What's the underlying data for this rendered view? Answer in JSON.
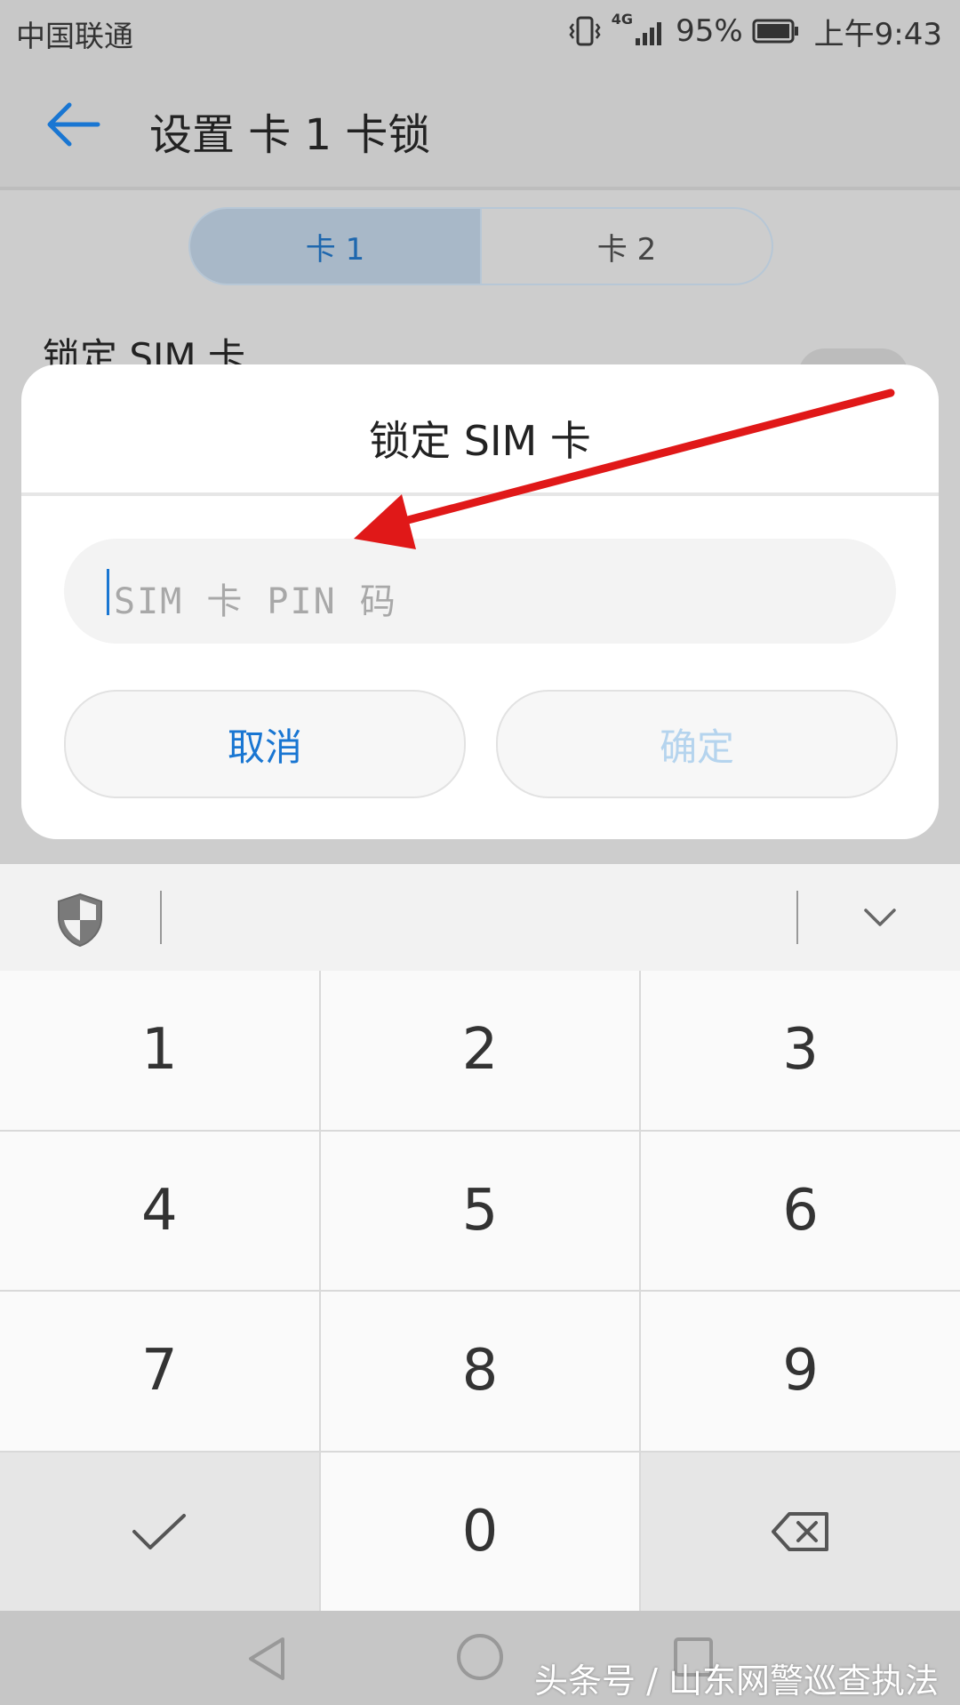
{
  "status_bar": {
    "carrier": "中国联通",
    "network": "4G",
    "battery": "95%",
    "time": "上午9:43",
    "icons": [
      "vibrate-icon",
      "signal-icon",
      "battery-icon"
    ]
  },
  "app_bar": {
    "title": "设置 卡 1 卡锁",
    "back_icon": "back-arrow-icon"
  },
  "sim_tabs": [
    "卡 1",
    "卡 2"
  ],
  "settings": {
    "lock_sim_label": "锁定 SIM 卡"
  },
  "dialog": {
    "title": "锁定 SIM 卡",
    "pin_placeholder": "SIM 卡 PIN 码",
    "cancel_label": "取消",
    "confirm_label": "确定"
  },
  "keyboard": {
    "keys": [
      "1",
      "2",
      "3",
      "4",
      "5",
      "6",
      "7",
      "8",
      "9",
      "",
      "0",
      ""
    ],
    "toolbar_icons": [
      "shield-icon",
      "chevron-down-icon"
    ]
  },
  "nav_bar": {
    "icons": [
      "nav-back-icon",
      "nav-home-icon",
      "nav-recents-icon"
    ]
  },
  "watermark": "头条号 / 山东网警巡查执法",
  "colors": {
    "accent": "#1976d2",
    "arrow": "#e01818",
    "disabled": "#b5d4ee"
  }
}
